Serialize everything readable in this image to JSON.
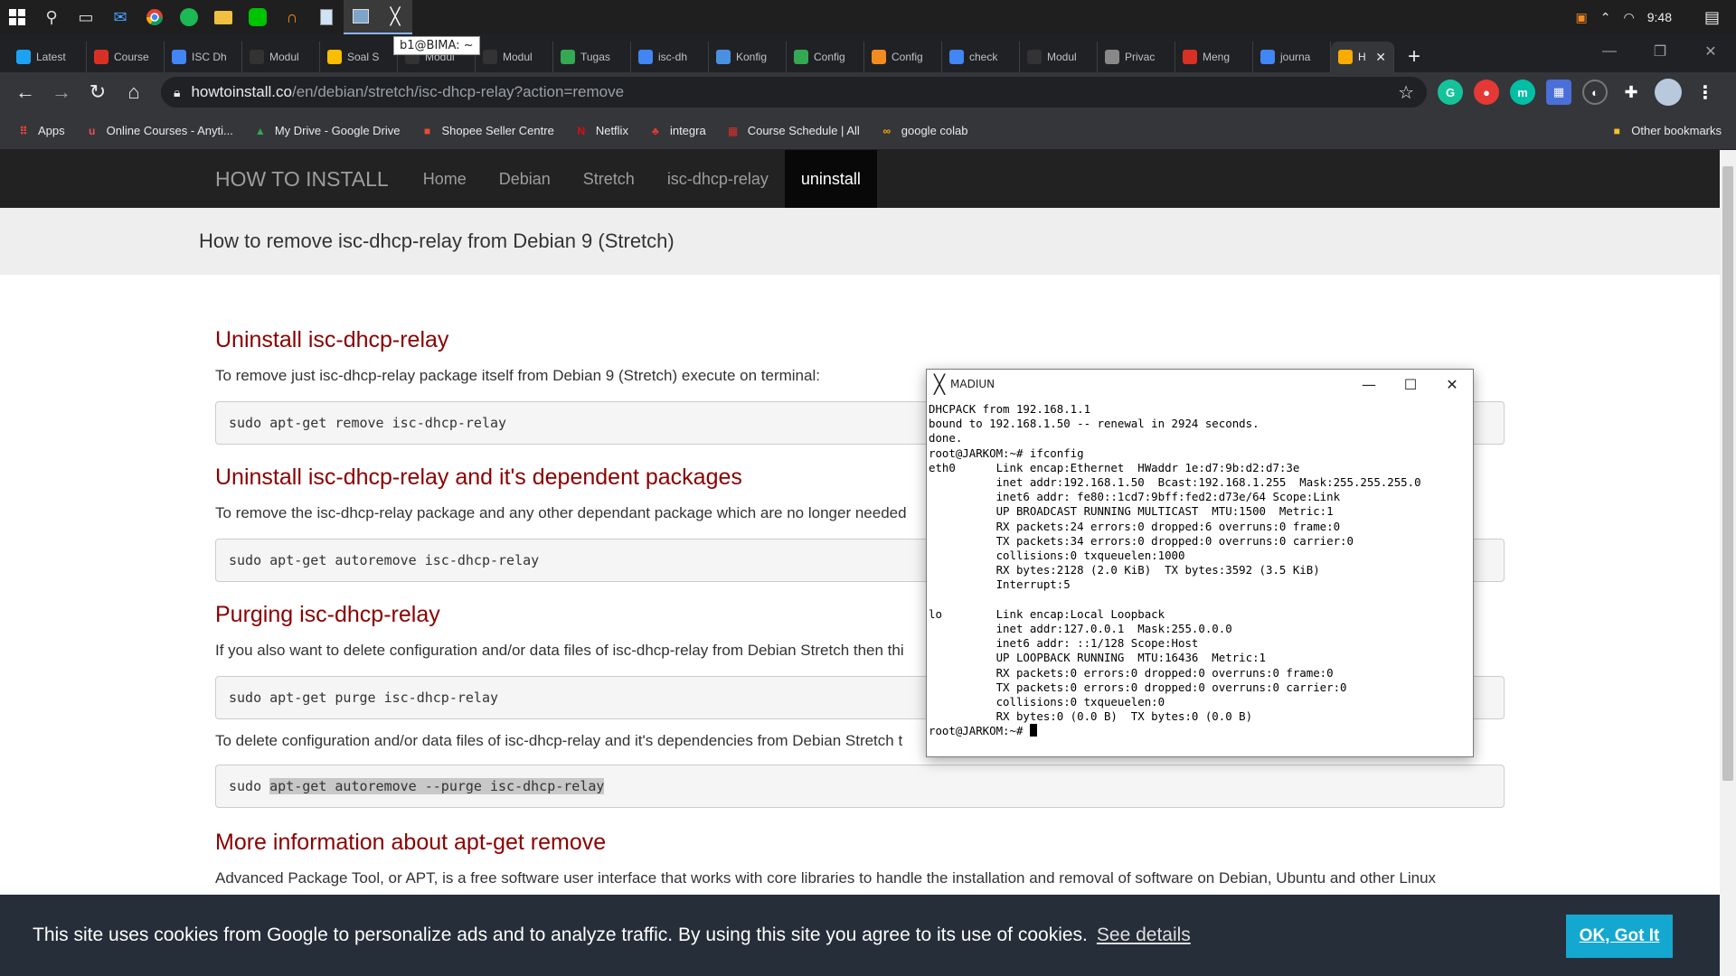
{
  "taskbar": {
    "time": "9:48",
    "tooltip": "b1@BIMA: ~"
  },
  "tabs": [
    {
      "label": "Latest",
      "color": "#1da1f2"
    },
    {
      "label": "Course",
      "color": "#d93025"
    },
    {
      "label": "ISC Dh",
      "color": "#4285f4"
    },
    {
      "label": "Modul",
      "color": "#333333"
    },
    {
      "label": "Soal S",
      "color": "#fbbc04"
    },
    {
      "label": "Modul",
      "color": "#333333"
    },
    {
      "label": "Modul",
      "color": "#333333"
    },
    {
      "label": "Tugas",
      "color": "#34a853"
    },
    {
      "label": "isc-dh",
      "color": "#4285f4"
    },
    {
      "label": "Konfig",
      "color": "#4a90e2"
    },
    {
      "label": "Config",
      "color": "#34a853"
    },
    {
      "label": "Config",
      "color": "#f28b20"
    },
    {
      "label": "check",
      "color": "#4285f4"
    },
    {
      "label": "Modul",
      "color": "#333333"
    },
    {
      "label": "Privac",
      "color": "#888888"
    },
    {
      "label": "Meng",
      "color": "#d93025"
    },
    {
      "label": "journa",
      "color": "#4285f4"
    },
    {
      "label": "H",
      "color": "#f9ab00"
    }
  ],
  "address": {
    "host": "howtoinstall.co",
    "path": "/en/debian/stretch/isc-dhcp-relay?action=remove"
  },
  "bookmarks": [
    {
      "label": "Apps",
      "icon": "apps-grid-icon"
    },
    {
      "label": "Online Courses - Anyti...",
      "icon": "udemy-icon"
    },
    {
      "label": "My Drive - Google Drive",
      "icon": "drive-icon"
    },
    {
      "label": "Shopee Seller Centre",
      "icon": "shopee-icon"
    },
    {
      "label": "Netflix",
      "icon": "netflix-icon"
    },
    {
      "label": "integra",
      "icon": "integra-icon"
    },
    {
      "label": "Course Schedule | All",
      "icon": "calendar-icon"
    },
    {
      "label": "google colab",
      "icon": "colab-icon"
    }
  ],
  "other_bookmarks": "Other bookmarks",
  "site": {
    "brand": "HOW TO INSTALL",
    "nav": [
      "Home",
      "Debian",
      "Stretch",
      "isc-dhcp-relay",
      "uninstall"
    ],
    "page_title": "How to remove isc-dhcp-relay from Debian 9 (Stretch)",
    "sections": {
      "s1_title": "Uninstall isc-dhcp-relay",
      "s1_text": "To remove just isc-dhcp-relay package itself from Debian 9 (Stretch) execute on terminal:",
      "s1_code": "sudo apt-get remove isc-dhcp-relay",
      "s2_title": "Uninstall isc-dhcp-relay and it's dependent packages",
      "s2_text": "To remove the isc-dhcp-relay package and any other dependant package which are no longer needed",
      "s2_code": "sudo apt-get autoremove isc-dhcp-relay",
      "s3_title": "Purging isc-dhcp-relay",
      "s3_text": "If you also want to delete configuration and/or data files of isc-dhcp-relay from Debian Stretch then thi",
      "s3_code": "sudo apt-get purge isc-dhcp-relay",
      "s3_text2": "To delete configuration and/or data files of isc-dhcp-relay and it's dependencies from Debian Stretch t",
      "s3_code2_prefix": "sudo ",
      "s3_code2_selected": "apt-get autoremove --purge isc-dhcp-relay",
      "s4_title": "More information about apt-get remove",
      "s4_text": "Advanced Package Tool, or APT, is a free software user interface that works with core libraries to handle the installation and removal of software on Debian, Ubuntu and other Linux"
    }
  },
  "cookie": {
    "message": "This site uses cookies from Google to personalize ads and to analyze traffic. By using this site you agree to its use of cookies.",
    "details": "See details",
    "ok": "OK, Got It"
  },
  "terminal": {
    "title": "MADIUN",
    "output": "DHCPACK from 192.168.1.1\nbound to 192.168.1.50 -- renewal in 2924 seconds.\ndone.\nroot@JARKOM:~# ifconfig\neth0      Link encap:Ethernet  HWaddr 1e:d7:9b:d2:d7:3e\n          inet addr:192.168.1.50  Bcast:192.168.1.255  Mask:255.255.255.0\n          inet6 addr: fe80::1cd7:9bff:fed2:d73e/64 Scope:Link\n          UP BROADCAST RUNNING MULTICAST  MTU:1500  Metric:1\n          RX packets:24 errors:0 dropped:6 overruns:0 frame:0\n          TX packets:34 errors:0 dropped:0 overruns:0 carrier:0\n          collisions:0 txqueuelen:1000\n          RX bytes:2128 (2.0 KiB)  TX bytes:3592 (3.5 KiB)\n          Interrupt:5\n\nlo        Link encap:Local Loopback\n          inet addr:127.0.0.1  Mask:255.0.0.0\n          inet6 addr: ::1/128 Scope:Host\n          UP LOOPBACK RUNNING  MTU:16436  Metric:1\n          RX packets:0 errors:0 dropped:0 overruns:0 frame:0\n          TX packets:0 errors:0 dropped:0 overruns:0 carrier:0\n          collisions:0 txqueuelen:0\n          RX bytes:0 (0.0 B)  TX bytes:0 (0.0 B)\n",
    "prompt": "root@JARKOM:~# "
  }
}
